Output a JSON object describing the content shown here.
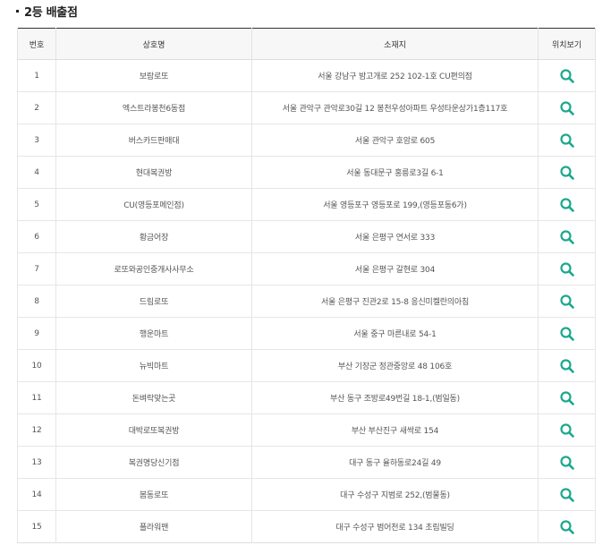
{
  "section": {
    "title": "2등 배출점"
  },
  "colors": {
    "accent": "#1aa88e",
    "header_bg": "#f7f7f7",
    "top_border": "#333333"
  },
  "table": {
    "headers": {
      "number": "번호",
      "name": "상호명",
      "address": "소재지",
      "map": "위치보기"
    },
    "map_icon": "search-icon",
    "rows": [
      {
        "number": "1",
        "name": "보람로또",
        "address": "서울 강남구 밤고개로 252 102-1호 CU편의점"
      },
      {
        "number": "2",
        "name": "엑스트라봉천6동점",
        "address": "서울 관악구 관악로30길 12 봉천우성아파트 우성타운상가1층117호"
      },
      {
        "number": "3",
        "name": "버스카드판매대",
        "address": "서울 관악구 호암로 605"
      },
      {
        "number": "4",
        "name": "현대복권방",
        "address": "서울 동대문구 홍릉로3길 6-1"
      },
      {
        "number": "5",
        "name": "CU(영등포메인점)",
        "address": "서울 영등포구 영등포로 199,(영등포동6가)"
      },
      {
        "number": "6",
        "name": "황금어장",
        "address": "서울 은평구 연서로 333"
      },
      {
        "number": "7",
        "name": "로또와공인중개사사무소",
        "address": "서울 은평구 갈현로 304"
      },
      {
        "number": "8",
        "name": "드림로또",
        "address": "서울 은평구 진관2로 15-8 응신미켈란의아침"
      },
      {
        "number": "9",
        "name": "행운마트",
        "address": "서울 중구 마른내로 54-1"
      },
      {
        "number": "10",
        "name": "뉴빅마트",
        "address": "부산 기장군 정관중앙로 48 106호"
      },
      {
        "number": "11",
        "name": "돈벼락맞는곳",
        "address": "부산 동구 조방로49번길 18-1,(범일동)"
      },
      {
        "number": "12",
        "name": "대박로또복권방",
        "address": "부산 부산진구 새싹로 154"
      },
      {
        "number": "13",
        "name": "복권명당신기점",
        "address": "대구 동구 율하동로24길 49"
      },
      {
        "number": "14",
        "name": "봄동로또",
        "address": "대구 수성구 지범로 252,(범물동)"
      },
      {
        "number": "15",
        "name": "플라워맨",
        "address": "대구 수성구 범어천로 134 초림빌딩"
      }
    ]
  }
}
